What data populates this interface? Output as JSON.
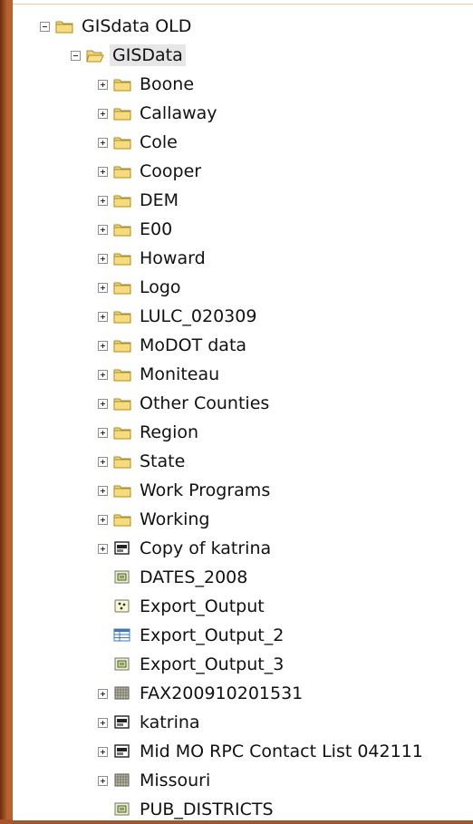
{
  "tree": {
    "root": {
      "label": "GISdata OLD",
      "icon": "folder-closed-icon",
      "expanded": true
    },
    "child": {
      "label": "GISData",
      "icon": "folder-open-icon",
      "expanded": true
    },
    "items": [
      {
        "label": "Boone",
        "icon": "folder-icon",
        "expander": "plus"
      },
      {
        "label": "Callaway",
        "icon": "folder-icon",
        "expander": "plus"
      },
      {
        "label": "Cole",
        "icon": "folder-icon",
        "expander": "plus"
      },
      {
        "label": "Cooper",
        "icon": "folder-icon",
        "expander": "plus"
      },
      {
        "label": "DEM",
        "icon": "folder-icon",
        "expander": "plus"
      },
      {
        "label": "E00",
        "icon": "folder-icon",
        "expander": "plus"
      },
      {
        "label": "Howard",
        "icon": "folder-icon",
        "expander": "plus"
      },
      {
        "label": "Logo",
        "icon": "folder-icon",
        "expander": "plus"
      },
      {
        "label": "LULC_020309",
        "icon": "folder-icon",
        "expander": "plus"
      },
      {
        "label": "MoDOT data",
        "icon": "folder-icon",
        "expander": "plus"
      },
      {
        "label": "Moniteau",
        "icon": "folder-icon",
        "expander": "plus"
      },
      {
        "label": "Other Counties",
        "icon": "folder-icon",
        "expander": "plus"
      },
      {
        "label": "Region",
        "icon": "folder-icon",
        "expander": "plus"
      },
      {
        "label": "State",
        "icon": "folder-icon",
        "expander": "plus"
      },
      {
        "label": "Work Programs",
        "icon": "folder-icon",
        "expander": "plus"
      },
      {
        "label": "Working",
        "icon": "folder-icon",
        "expander": "plus"
      },
      {
        "label": "Copy of katrina",
        "icon": "personal-geodatabase-icon",
        "expander": "plus"
      },
      {
        "label": "DATES_2008",
        "icon": "polygon-shapefile-icon",
        "expander": "none"
      },
      {
        "label": "Export_Output",
        "icon": "point-shapefile-icon",
        "expander": "none"
      },
      {
        "label": "Export_Output_2",
        "icon": "table-icon",
        "expander": "none"
      },
      {
        "label": "Export_Output_3",
        "icon": "polygon-shapefile-icon",
        "expander": "none"
      },
      {
        "label": "FAX200910201531",
        "icon": "raster-icon",
        "expander": "plus"
      },
      {
        "label": "katrina",
        "icon": "personal-geodatabase-icon",
        "expander": "plus"
      },
      {
        "label": "Mid MO RPC Contact List 042111",
        "icon": "personal-geodatabase-icon",
        "expander": "plus"
      },
      {
        "label": "Missouri",
        "icon": "raster-icon",
        "expander": "plus"
      },
      {
        "label": "PUB_DISTRICTS",
        "icon": "polygon-shapefile-icon",
        "expander": "none"
      }
    ]
  },
  "colors": {
    "frame": "#b8632f",
    "folder": "#f3d36b",
    "folder_border": "#b48a22",
    "selection": "#e6e6e6"
  }
}
